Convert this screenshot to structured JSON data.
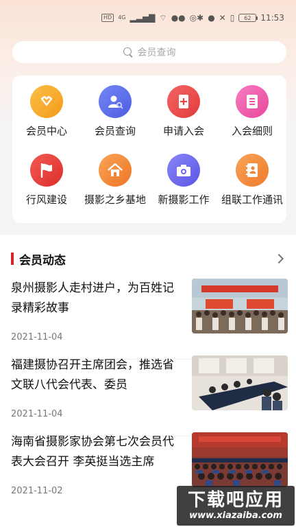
{
  "status_bar": {
    "hd": "HD",
    "network": "4G",
    "time": "11:53",
    "battery": "62"
  },
  "search": {
    "placeholder": "会员查询"
  },
  "grid": {
    "items": [
      {
        "label": "会员中心",
        "icon": "heart-down-icon",
        "color": "#f5a623"
      },
      {
        "label": "会员查询",
        "icon": "user-search-icon",
        "color": "#5b6de8"
      },
      {
        "label": "申请入会",
        "icon": "document-add-icon",
        "color": "#ee4d4d"
      },
      {
        "label": "入会细则",
        "icon": "list-icon",
        "color": "#ee5aa8"
      },
      {
        "label": "行风建设",
        "icon": "flag-icon",
        "color": "#e8403c"
      },
      {
        "label": "摄影之乡基地",
        "icon": "house-icon",
        "color": "#f38b3a"
      },
      {
        "label": "新摄影工作",
        "icon": "camera-icon",
        "color": "#6e6af0"
      },
      {
        "label": "组联工作通讯",
        "icon": "contact-book-icon",
        "color": "#f2893a"
      }
    ]
  },
  "news": {
    "title": "会员动态",
    "items": [
      {
        "headline": "泉州摄影人走村进户，为百姓记录精彩故事",
        "date": "2021-11-04"
      },
      {
        "headline": "福建摄协召开主席团会，推选省文联八代会代表、委员",
        "date": "2021-11-04"
      },
      {
        "headline": "海南省摄影家协会第七次会员代表大会召开 李英挺当选主席",
        "date": "2021-11-02"
      }
    ]
  },
  "watermark": {
    "main": "下载吧应用",
    "sub": "www.xiazaiba.com"
  }
}
